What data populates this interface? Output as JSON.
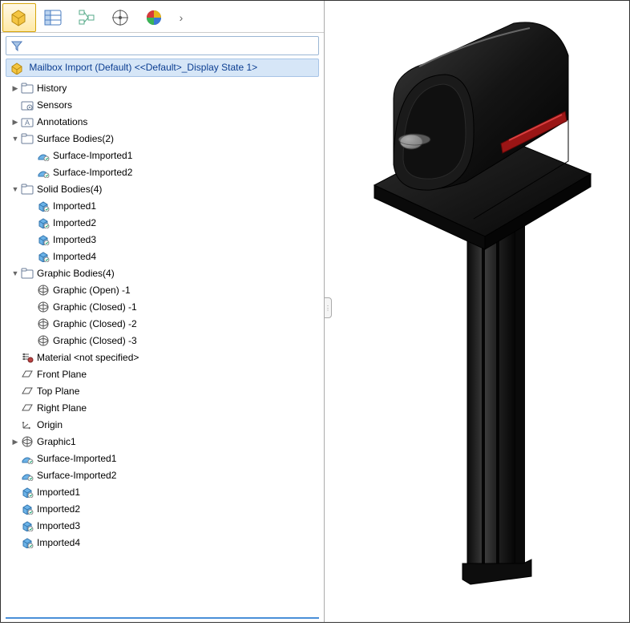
{
  "toolbar": {
    "tabs": [
      "feature-manager",
      "property-manager",
      "configuration-manager",
      "dim-xpert",
      "display-manager"
    ]
  },
  "root": "Mailbox Import (Default) <<Default>_Display State 1>",
  "tree": [
    {
      "level": 1,
      "exp": "▶",
      "icon": "folder",
      "label": "History"
    },
    {
      "level": 1,
      "exp": "",
      "icon": "sensor",
      "label": "Sensors"
    },
    {
      "level": 1,
      "exp": "▶",
      "icon": "annot",
      "label": "Annotations"
    },
    {
      "level": 1,
      "exp": "▼",
      "icon": "folder",
      "label": "Surface Bodies(2)"
    },
    {
      "level": 2,
      "exp": "",
      "icon": "surf",
      "label": "Surface-Imported1"
    },
    {
      "level": 2,
      "exp": "",
      "icon": "surf",
      "label": "Surface-Imported2"
    },
    {
      "level": 1,
      "exp": "▼",
      "icon": "folder",
      "label": "Solid Bodies(4)"
    },
    {
      "level": 2,
      "exp": "",
      "icon": "solid",
      "label": "Imported1"
    },
    {
      "level": 2,
      "exp": "",
      "icon": "solid",
      "label": "Imported2"
    },
    {
      "level": 2,
      "exp": "",
      "icon": "solid",
      "label": "Imported3"
    },
    {
      "level": 2,
      "exp": "",
      "icon": "solid",
      "label": "Imported4"
    },
    {
      "level": 1,
      "exp": "▼",
      "icon": "folder",
      "label": "Graphic Bodies(4)"
    },
    {
      "level": 2,
      "exp": "",
      "icon": "mesh",
      "label": "Graphic (Open) -1"
    },
    {
      "level": 2,
      "exp": "",
      "icon": "mesh",
      "label": "Graphic (Closed) -1"
    },
    {
      "level": 2,
      "exp": "",
      "icon": "mesh",
      "label": "Graphic (Closed) -2"
    },
    {
      "level": 2,
      "exp": "",
      "icon": "mesh",
      "label": "Graphic (Closed) -3"
    },
    {
      "level": 1,
      "exp": "",
      "icon": "mat",
      "label": "Material <not specified>"
    },
    {
      "level": 1,
      "exp": "",
      "icon": "plane",
      "label": "Front Plane"
    },
    {
      "level": 1,
      "exp": "",
      "icon": "plane",
      "label": "Top Plane"
    },
    {
      "level": 1,
      "exp": "",
      "icon": "plane",
      "label": "Right Plane"
    },
    {
      "level": 1,
      "exp": "",
      "icon": "origin",
      "label": "Origin"
    },
    {
      "level": 1,
      "exp": "▶",
      "icon": "mesh",
      "label": "Graphic1"
    },
    {
      "level": 1,
      "exp": "",
      "icon": "surf",
      "label": "Surface-Imported1"
    },
    {
      "level": 1,
      "exp": "",
      "icon": "surf",
      "label": "Surface-Imported2"
    },
    {
      "level": 1,
      "exp": "",
      "icon": "solid",
      "label": "Imported1"
    },
    {
      "level": 1,
      "exp": "",
      "icon": "solid",
      "label": "Imported2"
    },
    {
      "level": 1,
      "exp": "",
      "icon": "solid",
      "label": "Imported3"
    },
    {
      "level": 1,
      "exp": "",
      "icon": "solid",
      "label": "Imported4"
    }
  ],
  "icons": {
    "folder": "<svg class='icon' width='16' height='14'><rect x='1' y='3' width='14' height='10' rx='1' fill='#fff' stroke='#6b7e99'/><rect x='1' y='1' width='6' height='3' rx='1' fill='#fff' stroke='#6b7e99'/></svg>",
    "sensor": "<svg class='icon' width='16' height='14'><rect x='1' y='3' width='14' height='10' rx='1' fill='#fff' stroke='#6b7e99'/><circle cx='11' cy='10' r='3' fill='#fff' stroke='#6b7e99'/><circle cx='11' cy='10' r='1' fill='#6b7e99'/></svg>",
    "annot": "<svg class='icon' width='16' height='14'><rect x='1' y='3' width='14' height='10' rx='1' fill='#fff' stroke='#6b7e99'/><text x='8' y='11' font-size='9' text-anchor='middle' fill='#6b7e99'>A</text></svg>",
    "surf": "<svg class='icon' width='16' height='14'><path d='M2 10 Q8 2 14 10 L14 12 L2 12 Z' fill='#6cb3e8' stroke='#3476ae'/><circle cx='12' cy='11' r='3' fill='#fff' stroke='#888'/><path d='M11 11 l1 1 l2 -2' stroke='#2a7' fill='none'/></svg>",
    "solid": "<svg class='icon' width='16' height='14'><path d='M3 5 L8 2 L13 5 L13 11 L8 14 L3 11 Z' fill='#6cb3e8' stroke='#3476ae'/><path d='M3 5 L8 8 L13 5 M8 8 L8 14' stroke='#3476ae' fill='none'/><circle cx='12' cy='11' r='3' fill='#fff' stroke='#888'/><path d='M11 11 l1 1 l2 -2' stroke='#2a7' fill='none'/></svg>",
    "mesh": "<svg class='icon' width='16' height='14'><circle cx='8' cy='7' r='6' fill='none' stroke='#555'/><path d='M2 7 Q8 2 14 7 M2 7 Q8 12 14 7 M8 1 L8 13' stroke='#555' fill='none'/></svg>",
    "mat": "<svg class='icon' width='16' height='14'><line x1='2' y1='3' x2='10' y2='3' stroke='#555'/><line x1='2' y1='6' x2='10' y2='6' stroke='#555'/><line x1='2' y1='9' x2='10' y2='9' stroke='#555'/><circle cx='4' cy='3' r='1.2' fill='#555'/><circle cx='4' cy='6' r='1.2' fill='#555'/><circle cx='4' cy='9' r='1.2' fill='#555'/><circle cx='12' cy='10' r='3' fill='#b44' stroke='#722'/></svg>",
    "plane": "<svg class='icon' width='16' height='14'><path d='M2 10 L6 3 L14 3 L10 10 Z' fill='none' stroke='#555'/></svg>",
    "origin": "<svg class='icon' width='16' height='14'><path d='M3 11 L3 3 M3 11 L12 11 M3 11 L9 6' stroke='#555' fill='none'/><path d='M3 3 l-1.5 2 l3 0 Z M12 11 l-2 -1.5 l0 3 Z' fill='#555'/></svg>",
    "filter": "<svg class='icon' width='14' height='14'><path d='M1 2 L13 2 L8 8 L8 13 L6 11 L6 8 Z' fill='#a7c4e6' stroke='#4d79b8'/></svg>",
    "part": "<svg class='icon' width='18' height='16'><path d='M3 6 L9 2 L15 6 L15 12 L9 16 L3 12 Z' fill='#f4c542' stroke='#b88a12'/><path d='M3 6 L9 10 L15 6 M9 10 L9 16' stroke='#b88a12' fill='none'/></svg>"
  },
  "tab_icons": {
    "feature-manager": "<svg width='26' height='24'><path d='M4 8 L12 3 L20 8 L20 17 L12 22 L4 17 Z' fill='#f4c542' stroke='#b88a12'/><path d='M4 8 L12 13 L20 8 M12 13 L12 22' stroke='#b88a12' fill='none'/></svg>",
    "property-manager": "<svg width='26' height='24'><rect x='3' y='3' width='20' height='18' rx='2' fill='#fff' stroke='#4a7cc0'/><rect x='3' y='3' width='7' height='18' fill='#bcd4ef' stroke='#4a7cc0'/><line x1='3' y1='9' x2='23' y2='9' stroke='#4a7cc0'/><line x1='3' y1='15' x2='23' y2='15' stroke='#4a7cc0'/></svg>",
    "configuration-manager": "<svg width='26' height='24'><rect x='4' y='3' width='6' height='5' fill='#fff' stroke='#5a8'/><rect x='4' y='15' width='6' height='5' fill='#fff' stroke='#5a8'/><rect x='15' y='9' width='7' height='6' fill='#fff' stroke='#5a8'/><path d='M10 5 L15 12 M10 18 L15 12' stroke='#5a8' fill='none'/></svg>",
    "dim-xpert": "<svg width='26' height='24'><circle cx='13' cy='12' r='9' fill='none' stroke='#555'/><line x1='13' y1='2' x2='13' y2='22' stroke='#555'/><line x1='3' y1='12' x2='23' y2='12' stroke='#555'/><circle cx='13' cy='12' r='2' fill='#555'/></svg>",
    "display-manager": "<svg width='26' height='24'><circle cx='13' cy='12' r='9' fill='#333'/><path d='M13 3 A9 9 0 0 1 22 12 L13 12 Z' fill='#e8b61c'/><path d='M13 12 L22 12 A9 9 0 0 1 13 21 Z' fill='#3a78d8'/><path d='M13 3 A9 9 0 0 0 4 12 L13 12 Z' fill='#d83a3a'/><path d='M4 12 A9 9 0 0 0 13 21 L13 12 Z' fill='#3ab557'/></svg>"
  }
}
